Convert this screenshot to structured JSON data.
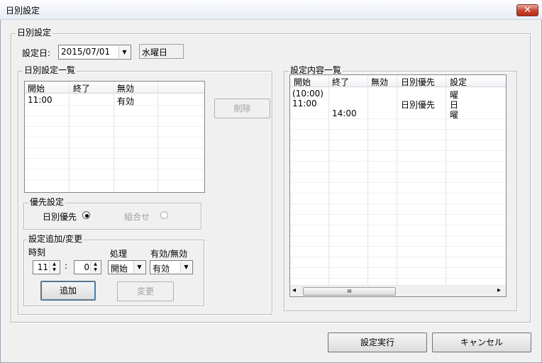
{
  "window": {
    "title": "日別設定",
    "close_glyph": "✕"
  },
  "daily_group": {
    "legend": "日別設定"
  },
  "date_row": {
    "label": "設定日:",
    "date_value": "2015/07/01",
    "weekday": "水曜日"
  },
  "daily_list": {
    "legend": "日別設定一覧",
    "columns": [
      "開始",
      "終了",
      "無効"
    ],
    "rows": [
      {
        "start": "11:00",
        "end": "",
        "invalid": "有効"
      }
    ]
  },
  "delete_label": "削除",
  "priority": {
    "legend": "優先設定",
    "option1": "日別優先",
    "option2": "組合せ"
  },
  "add_change": {
    "legend": "設定追加/変更",
    "time_label": "時刻",
    "hour": "11",
    "colon": ":",
    "minute": "0",
    "process_label": "処理",
    "process_value": "開始",
    "valid_label": "有効/無効",
    "valid_value": "有効",
    "add_label": "追加",
    "change_label": "変更"
  },
  "content_list": {
    "legend": "設定内容一覧",
    "columns": [
      "開始",
      "終了",
      "無効",
      "日別優先",
      "設定"
    ],
    "rows": [
      {
        "start": "(10:00)",
        "end": "",
        "invalid": "",
        "priority": "",
        "setting": "曜"
      },
      {
        "start": "11:00",
        "end": "",
        "invalid": "",
        "priority": "日別優先",
        "setting": "日"
      },
      {
        "start": "",
        "end": "14:00",
        "invalid": "",
        "priority": "",
        "setting": "曜"
      }
    ],
    "scroll_thumb_glyph": "III",
    "scroll_left": "◂",
    "scroll_right": "▸"
  },
  "footer": {
    "execute_label": "設定実行",
    "cancel_label": "キャンセル"
  }
}
